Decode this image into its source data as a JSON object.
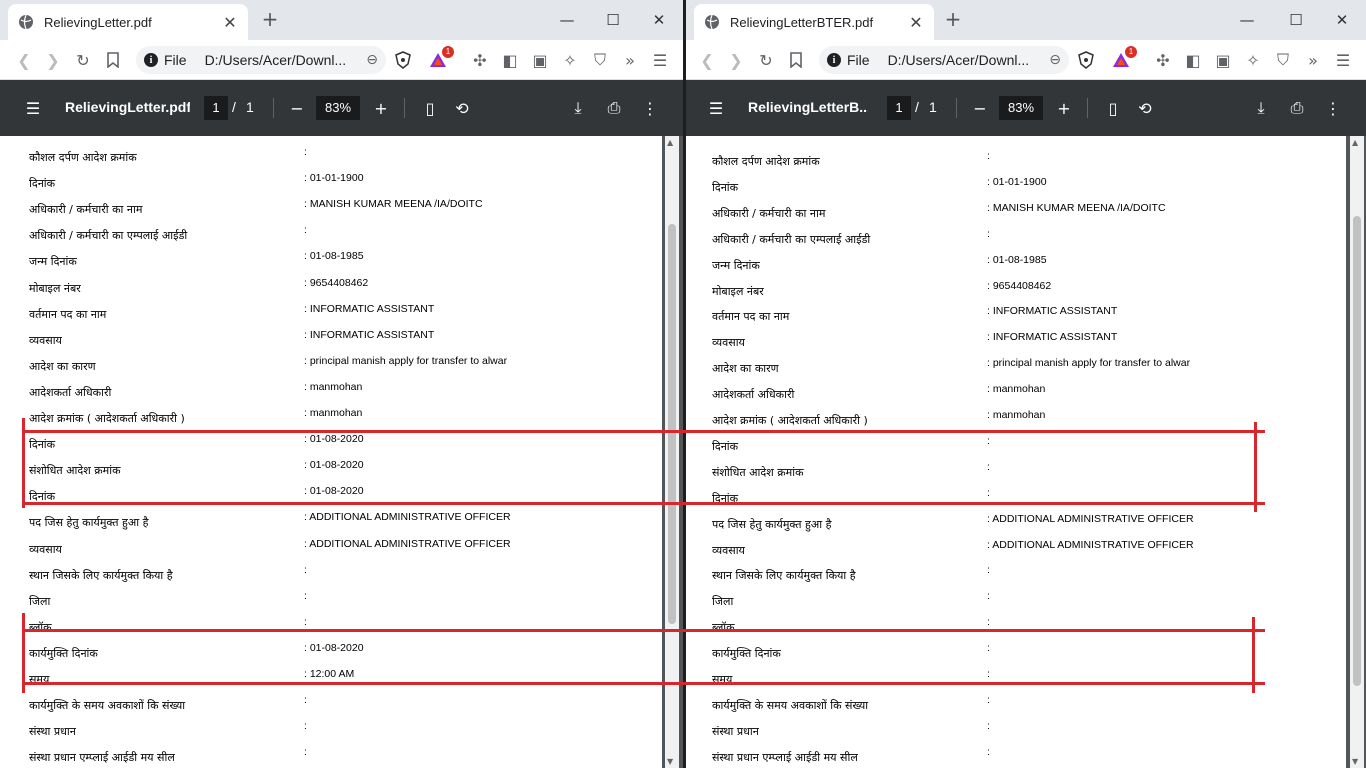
{
  "left": {
    "tab_title": "RelievingLetter.pdf",
    "omnibox": {
      "scheme": "File",
      "url": "D:/Users/Acer/Downl..."
    },
    "pdf": {
      "title": "RelievingLetter.pdf",
      "page": "1",
      "total": "1",
      "zoom": "83%"
    },
    "rows": [
      {
        "label": "कौशल दर्पण आदेश क्रमांक",
        "value": ":"
      },
      {
        "label": "दिनांक",
        "value": ": 01-01-1900"
      },
      {
        "label": "अधिकारी / कर्मचारी का नाम",
        "value": ": MANISH KUMAR MEENA /IA/DOITC"
      },
      {
        "label": "अधिकारी / कर्मचारी का एम्पलाई आईडी",
        "value": ":"
      },
      {
        "label": "जन्म दिनांक",
        "value": ": 01-08-1985"
      },
      {
        "label": "मोबाइल नंबर",
        "value": ": 9654408462"
      },
      {
        "label": "वर्तमान पद का नाम",
        "value": ": INFORMATIC ASSISTANT"
      },
      {
        "label": "व्यवसाय",
        "value": ": INFORMATIC ASSISTANT"
      },
      {
        "label": "आदेश का कारण",
        "value": ": principal manish apply for transfer to alwar"
      },
      {
        "label": "आदेशकर्ता अधिकारी",
        "value": ": manmohan"
      },
      {
        "label": "आदेश क्रमांक ( आदेशकर्ता अधिकारी )",
        "value": ": manmohan"
      },
      {
        "label": "दिनांक",
        "value": ": 01-08-2020"
      },
      {
        "label": "संशोधित आदेश क्रमांक",
        "value": ": 01-08-2020"
      },
      {
        "label": "दिनांक",
        "value": ": 01-08-2020"
      },
      {
        "label": "पद जिस हेतु कार्यमुक्त हुआ है",
        "value": ": ADDITIONAL ADMINISTRATIVE OFFICER"
      },
      {
        "label": "व्यवसाय",
        "value": ": ADDITIONAL ADMINISTRATIVE OFFICER"
      },
      {
        "label": "स्थान जिसके लिए कार्यमुक्त किया है",
        "value": ":"
      },
      {
        "label": "जिला",
        "value": ":"
      },
      {
        "label": "ब्लॉक",
        "value": ":"
      },
      {
        "label": "कार्यमुक्ति दिनांक",
        "value": ": 01-08-2020"
      },
      {
        "label": "समय",
        "value": ": 12:00 AM"
      },
      {
        "label": "कार्यमुक्ति के समय अवकाशों कि संख्या",
        "value": ":"
      },
      {
        "label": "संस्था प्रधान",
        "value": ":"
      },
      {
        "label": "संस्था प्रधान एम्प्लाई आईडी मय सील",
        "value": ":"
      }
    ]
  },
  "right": {
    "tab_title": "RelievingLetterBTER.pdf",
    "omnibox": {
      "scheme": "File",
      "url": "D:/Users/Acer/Downl..."
    },
    "pdf": {
      "title": "RelievingLetterB...",
      "page": "1",
      "total": "1",
      "zoom": "83%"
    },
    "rows": [
      {
        "label": "कौशल दर्पण आदेश क्रमांक",
        "value": ":"
      },
      {
        "label": "दिनांक",
        "value": ": 01-01-1900"
      },
      {
        "label": "अधिकारी / कर्मचारी का नाम",
        "value": ": MANISH KUMAR MEENA /IA/DOITC"
      },
      {
        "label": "अधिकारी / कर्मचारी का एम्पलाई आईडी",
        "value": ":"
      },
      {
        "label": "जन्म दिनांक",
        "value": ": 01-08-1985"
      },
      {
        "label": "मोबाइल नंबर",
        "value": ": 9654408462"
      },
      {
        "label": "वर्तमान पद का नाम",
        "value": ": INFORMATIC ASSISTANT"
      },
      {
        "label": "व्यवसाय",
        "value": ": INFORMATIC ASSISTANT"
      },
      {
        "label": "आदेश का कारण",
        "value": ": principal manish apply for transfer to alwar"
      },
      {
        "label": "आदेशकर्ता अधिकारी",
        "value": ": manmohan"
      },
      {
        "label": "आदेश क्रमांक ( आदेशकर्ता अधिकारी )",
        "value": ": manmohan"
      },
      {
        "label": "दिनांक",
        "value": ":"
      },
      {
        "label": "संशोधित आदेश क्रमांक",
        "value": ":"
      },
      {
        "label": "दिनांक",
        "value": ":"
      },
      {
        "label": "पद जिस हेतु कार्यमुक्त हुआ है",
        "value": ": ADDITIONAL ADMINISTRATIVE OFFICER"
      },
      {
        "label": "व्यवसाय",
        "value": ": ADDITIONAL ADMINISTRATIVE OFFICER"
      },
      {
        "label": "स्थान जिसके लिए कार्यमुक्त किया है",
        "value": ":"
      },
      {
        "label": "जिला",
        "value": ":"
      },
      {
        "label": "ब्लॉक",
        "value": ":"
      },
      {
        "label": "कार्यमुक्ति दिनांक",
        "value": ":"
      },
      {
        "label": "समय",
        "value": ":"
      },
      {
        "label": "कार्यमुक्ति के समय अवकाशों कि संख्या",
        "value": ":"
      },
      {
        "label": "संस्था प्रधान",
        "value": ":"
      },
      {
        "label": "संस्था प्रधान एम्प्लाई आईडी मय सील",
        "value": ":"
      }
    ]
  },
  "icons": [
    "globe-icon",
    "close-icon",
    "new-tab-icon",
    "minimize-icon",
    "maximize-icon",
    "back-icon",
    "forward-icon",
    "reload-icon",
    "bookmark-icon",
    "info-icon",
    "zoom-out-icon",
    "brave-shield-icon",
    "brave-rewards-icon",
    "extensions-icon",
    "sidebar-icon",
    "wallet-icon",
    "leo-icon",
    "vpn-icon",
    "more-chevrons-icon",
    "menu-icon",
    "download-icon",
    "print-icon",
    "more-vert-icon",
    "fit-page-icon",
    "rotate-icon"
  ],
  "colors": {
    "highlight": "#d7262c",
    "pdf_toolbar": "#323639",
    "viewer_bg": "#525659"
  },
  "badge": "1"
}
